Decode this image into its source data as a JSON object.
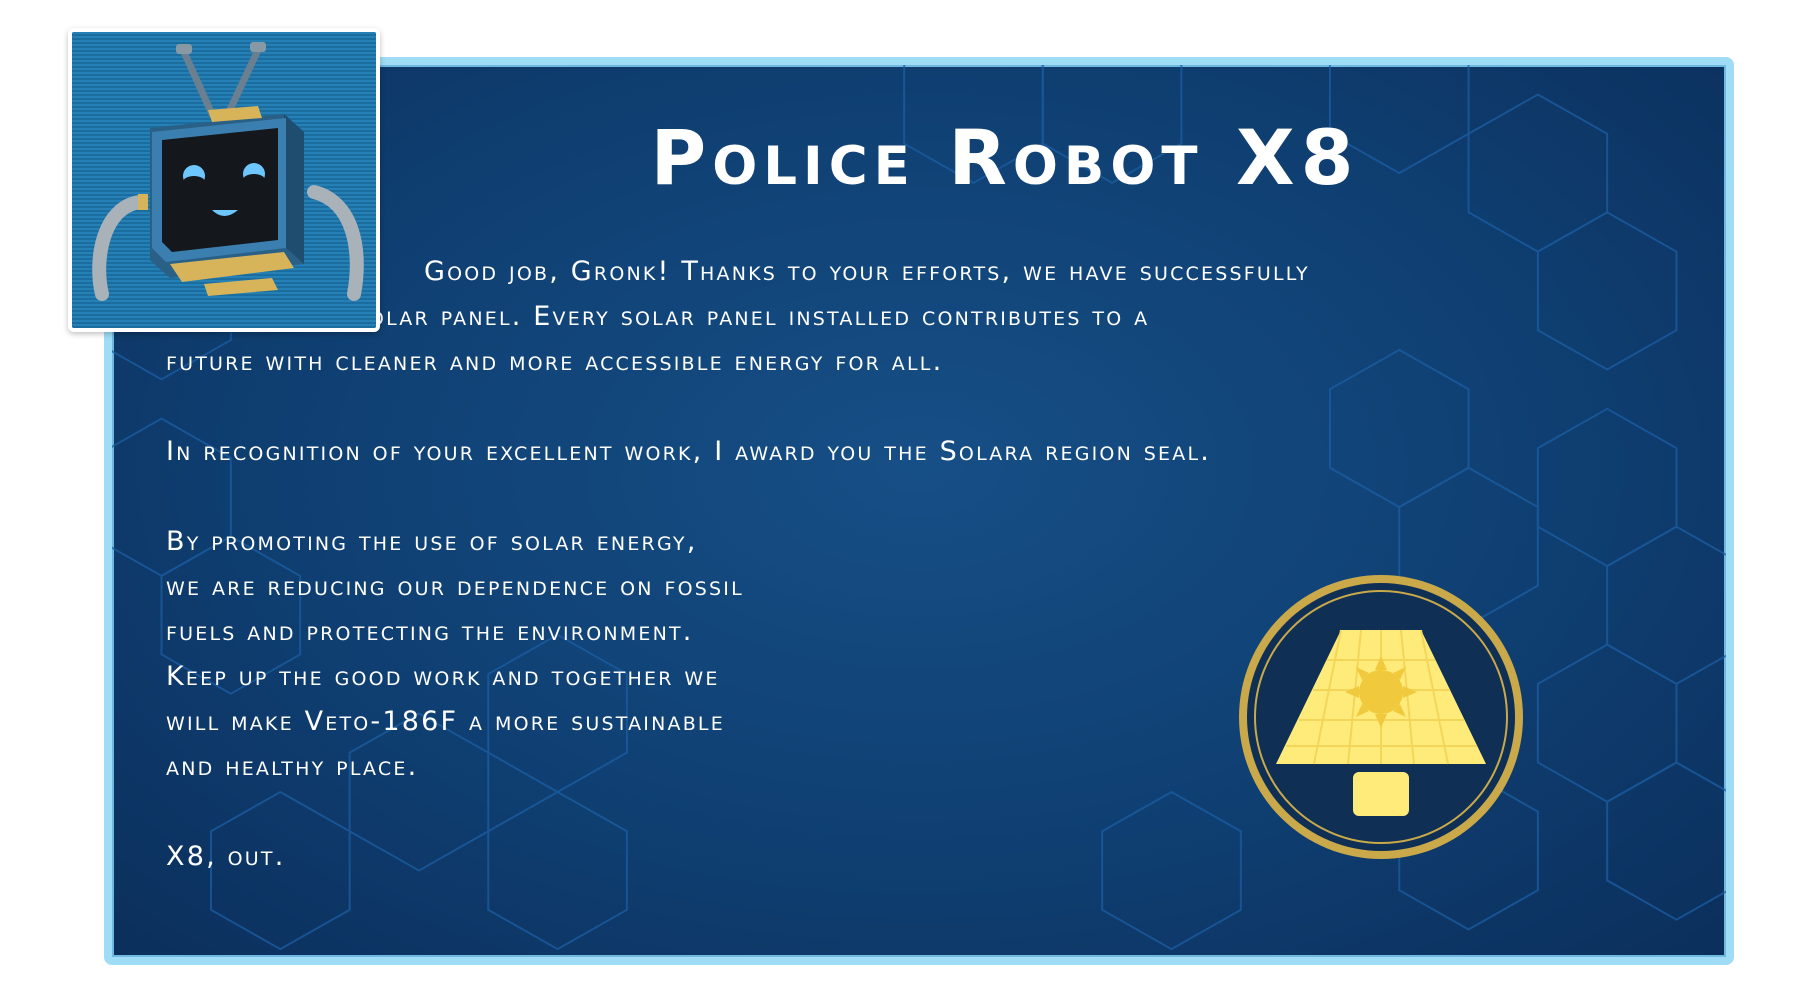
{
  "dialog": {
    "title": "Police Robot X8",
    "paragraph1": {
      "line1": "Good job, Gronk! Thanks to your efforts, we have successfully",
      "line2": "installed the solar panel. Every solar panel installed contributes to a",
      "line3": "future with cleaner and more accessible energy for all."
    },
    "paragraph2": "In recognition of your excellent work, I award you the Solara region seal.",
    "paragraph3": {
      "line1": "By promoting the use of solar energy,",
      "line2": "we are reducing our dependence on fossil",
      "line3": "fuels and protecting the environment.",
      "line4": "Keep up the good work and together we",
      "line5": "will make Veto-186F a more sustainable",
      "line6": "and healthy place."
    },
    "signoff": "X8, out."
  },
  "portrait": {
    "icon": "robot-portrait-icon"
  },
  "seal": {
    "icon": "solar-panel-seal-icon"
  },
  "colors": {
    "panel_bg": "#0f3f72",
    "panel_border": "#9fdcf5",
    "seal_gold": "#c9a94a",
    "seal_panel": "#ffeb7a"
  }
}
